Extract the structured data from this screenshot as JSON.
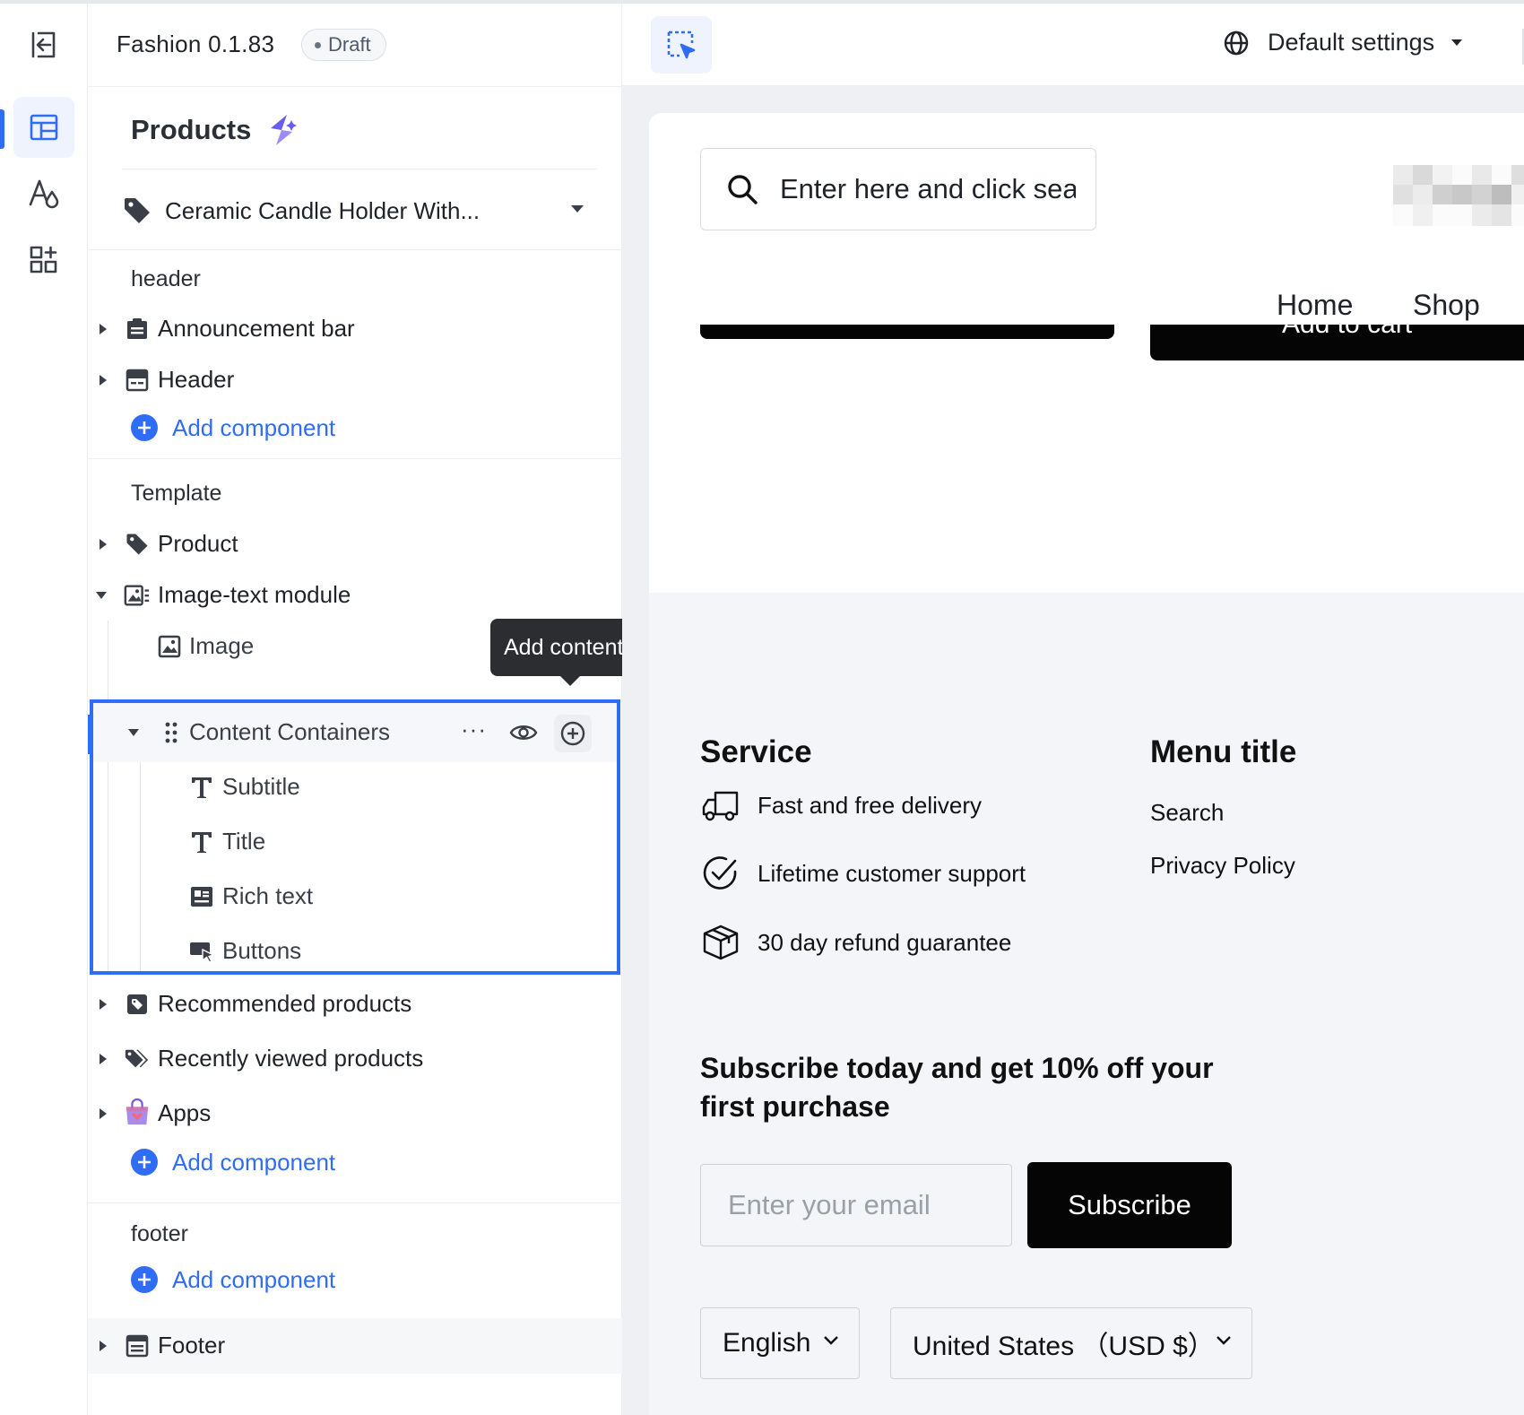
{
  "app": {
    "title": "Fashion 0.1.83",
    "status": "Draft"
  },
  "rail": {
    "icons": [
      "exit-icon",
      "layout-icon",
      "theme-icon",
      "apps-icon"
    ]
  },
  "sidebar": {
    "page_title": "Products",
    "product_selector": "Ceramic Candle Holder With...",
    "sections": {
      "header": {
        "label": "header",
        "items": [
          "Announcement bar",
          "Header"
        ],
        "add_label": "Add component"
      },
      "template": {
        "label": "Template",
        "items": {
          "product": "Product",
          "image_text": "Image-text module",
          "image": "Image",
          "content_containers": "Content Containers",
          "subtitle": "Subtitle",
          "title": "Title",
          "rich_text": "Rich text",
          "buttons": "Buttons",
          "recommended": "Recommended products",
          "recently_viewed": "Recently viewed products",
          "apps": "Apps"
        },
        "add_label": "Add component"
      },
      "footer": {
        "label": "footer",
        "add_label": "Add component",
        "items": [
          "Footer"
        ]
      }
    },
    "tooltip": "Add content",
    "more_label": "···"
  },
  "topbar": {
    "settings_label": "Default settings"
  },
  "preview": {
    "search_placeholder": "Enter here and click search",
    "nav": [
      "Home",
      "Shop"
    ],
    "cart_label": "Add to cart",
    "service": {
      "title": "Service",
      "items": [
        "Fast and free delivery",
        "Lifetime customer support",
        "30 day refund guarantee"
      ]
    },
    "menu": {
      "title": "Menu title",
      "links": [
        "Search",
        "Privacy Policy"
      ]
    },
    "subscribe": {
      "title": "Subscribe today and get 10% off your first purchase",
      "email_placeholder": "Enter your email",
      "button": "Subscribe"
    },
    "language": "English",
    "currency": "United States （USD $）"
  },
  "colors": {
    "accent": "#2f6df6",
    "tooltip": "#2b2d31",
    "black": "#050505"
  }
}
